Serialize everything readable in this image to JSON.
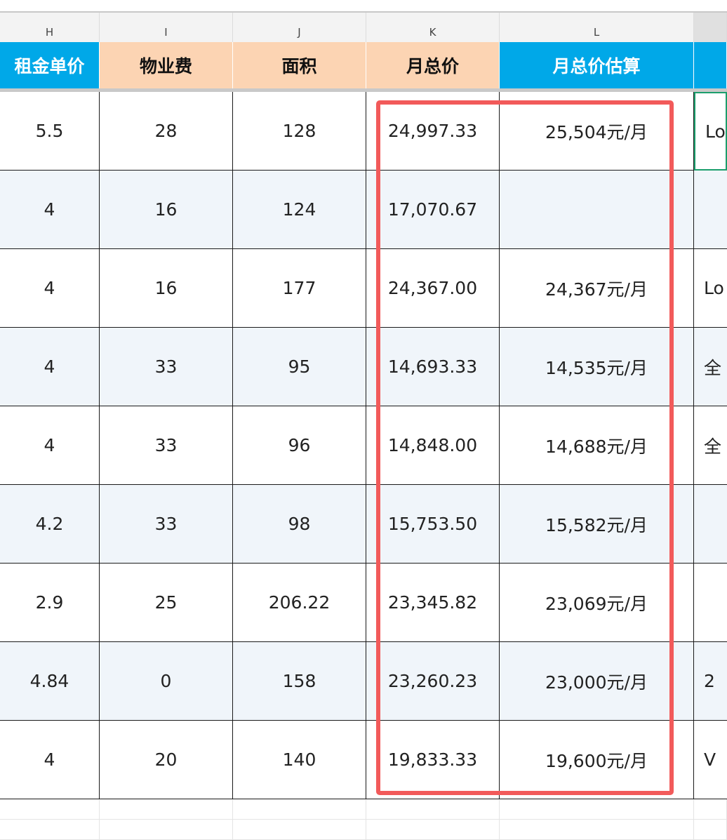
{
  "column_letters": [
    "H",
    "I",
    "J",
    "K",
    "L",
    ""
  ],
  "headers": [
    "租金单价",
    "物业费",
    "面积",
    "月总价",
    "月总价估算",
    ""
  ],
  "header_colors": {
    "blue": "#00a8e8",
    "peach": "#fcd4b3",
    "highlight": "#f25a5a",
    "selection": "#1b9e6c"
  },
  "rows": [
    {
      "H": "5.5",
      "I": "28",
      "J": "128",
      "K": "24,997.33",
      "L": "25,504元/月",
      "M": "Log"
    },
    {
      "H": "4",
      "I": "16",
      "J": "124",
      "K": "17,070.67",
      "L": "",
      "M": ""
    },
    {
      "H": "4",
      "I": "16",
      "J": "177",
      "K": "24,367.00",
      "L": "24,367元/月",
      "M": "Lo"
    },
    {
      "H": "4",
      "I": "33",
      "J": "95",
      "K": "14,693.33",
      "L": "14,535元/月",
      "M": "全"
    },
    {
      "H": "4",
      "I": "33",
      "J": "96",
      "K": "14,848.00",
      "L": "14,688元/月",
      "M": "全"
    },
    {
      "H": "4.2",
      "I": "33",
      "J": "98",
      "K": "15,753.50",
      "L": "15,582元/月",
      "M": ""
    },
    {
      "H": "2.9",
      "I": "25",
      "J": "206.22",
      "K": "23,345.82",
      "L": "23,069元/月",
      "M": ""
    },
    {
      "H": "4.84",
      "I": "0",
      "J": "158",
      "K": "23,260.23",
      "L": "23,000元/月",
      "M": "2"
    },
    {
      "H": "4",
      "I": "20",
      "J": "140",
      "K": "19,833.33",
      "L": "19,600元/月",
      "M": "V"
    }
  ]
}
